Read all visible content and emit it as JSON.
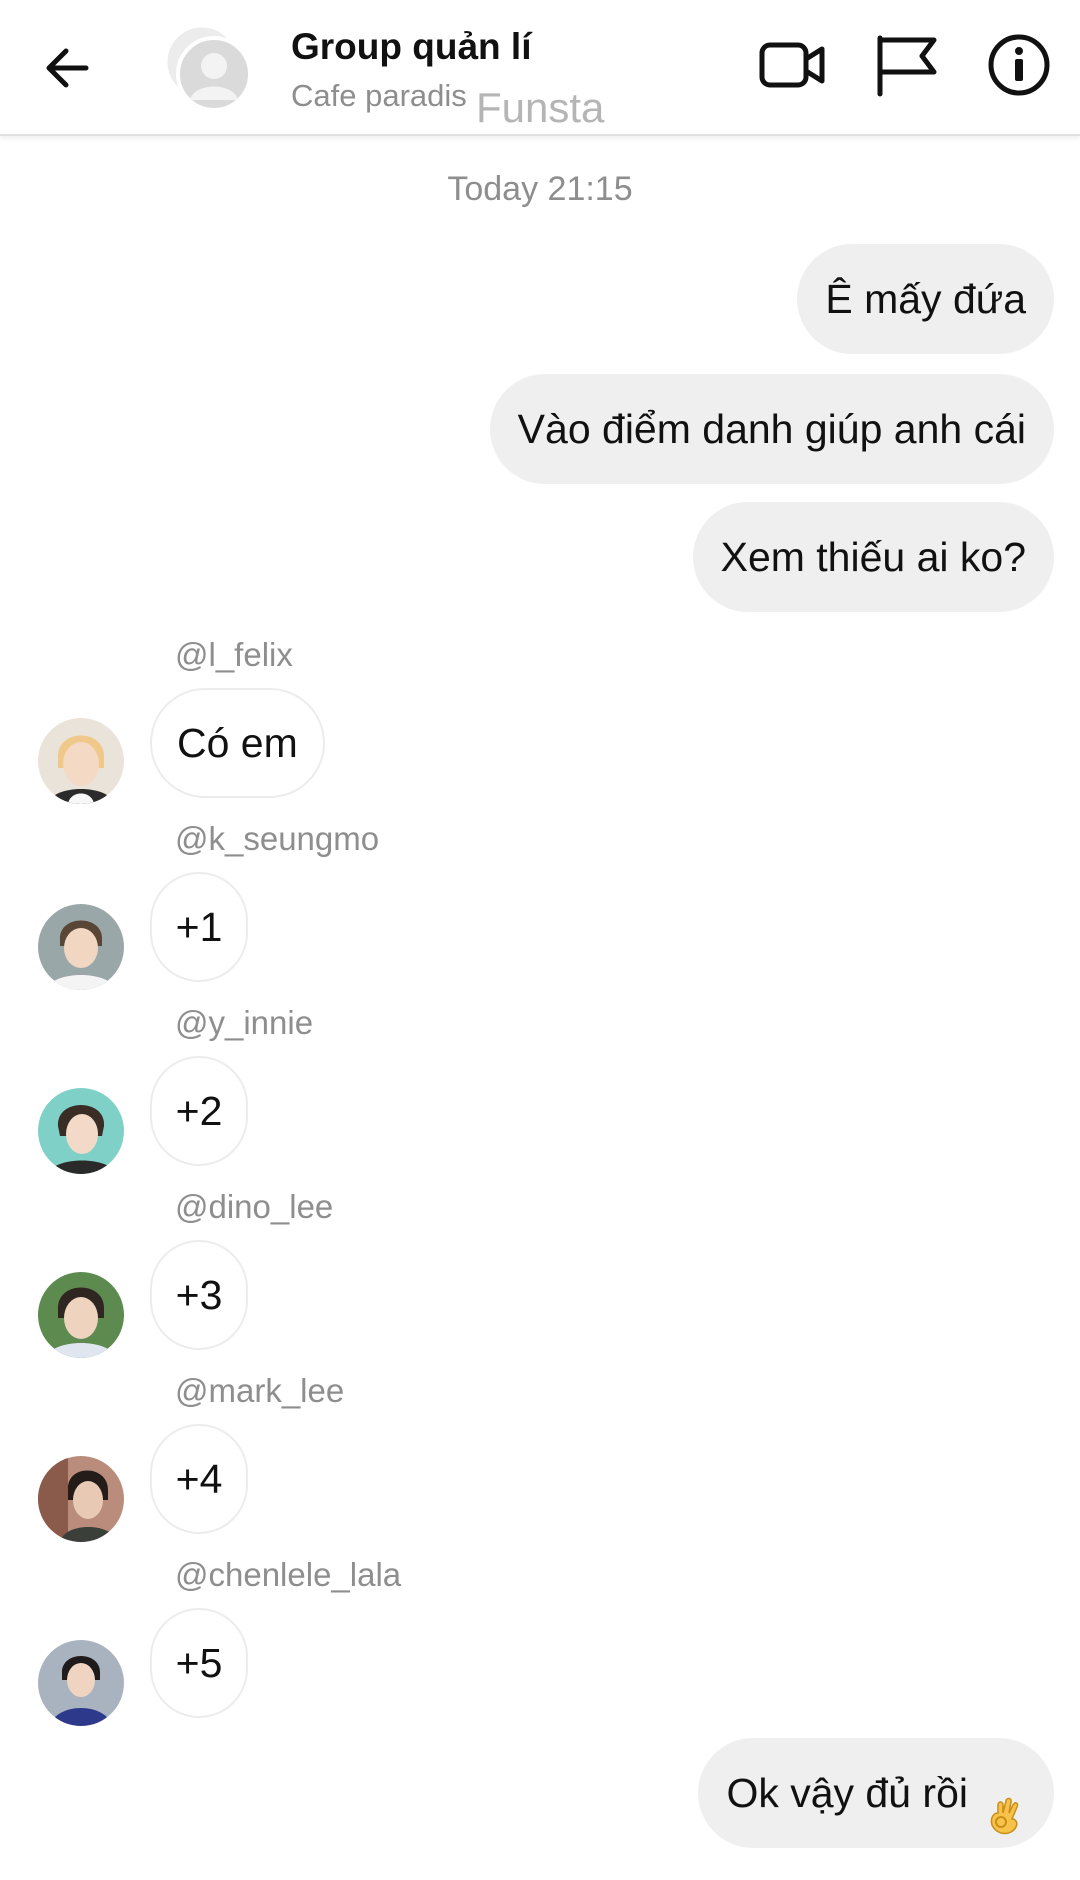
{
  "header": {
    "title": "Group quản lí",
    "subtitle": "Cafe paradis",
    "subtitle_extra": "Funsta",
    "icons": [
      "back-arrow-icon",
      "group-avatar-icon",
      "video-camera-icon",
      "flag-icon",
      "info-icon"
    ]
  },
  "chat": {
    "timestamp": "Today 21:15",
    "outgoing": [
      {
        "text": "Ê mấy đứa"
      },
      {
        "text": "Vào điểm danh giúp anh cái"
      },
      {
        "text": "Xem thiếu ai ko?"
      }
    ],
    "incoming": [
      {
        "sender": "@l_felix",
        "text": "Có em"
      },
      {
        "sender": "@k_seungmo",
        "text": "+1"
      },
      {
        "sender": "@y_innie",
        "text": "+2"
      },
      {
        "sender": "@dino_lee",
        "text": "+3"
      },
      {
        "sender": "@mark_lee",
        "text": "+4"
      },
      {
        "sender": "@chenlele_lala",
        "text": "+5"
      }
    ],
    "final": {
      "text": "Ok vậy đủ rồi",
      "emoji": "ok-hand-emoji"
    }
  },
  "colors": {
    "outgoing_bubble": "#efefef",
    "incoming_border": "#ececec",
    "muted_text": "#8e8e8e"
  }
}
